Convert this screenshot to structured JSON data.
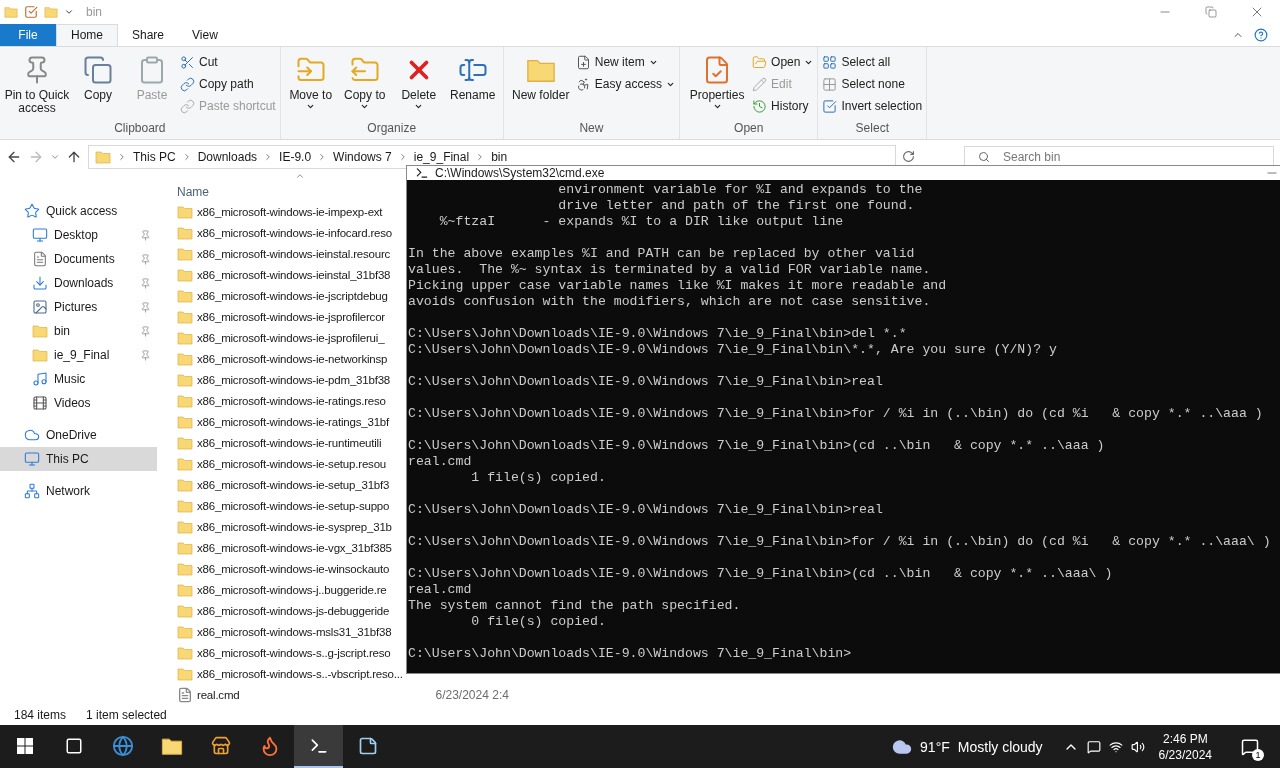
{
  "explorer": {
    "title": "bin",
    "tabs": [
      {
        "label": "File",
        "kind": "file",
        "selected": false
      },
      {
        "label": "Home",
        "kind": "tab",
        "selected": true
      },
      {
        "label": "Share",
        "kind": "tab",
        "selected": false
      },
      {
        "label": "View",
        "kind": "tab",
        "selected": false
      }
    ],
    "ribbon": [
      {
        "label": "Clipboard",
        "large": [
          {
            "label": "Pin to Quick access",
            "kind": "pin",
            "disabled": false,
            "menu": false
          },
          {
            "label": "Copy",
            "kind": "copy",
            "disabled": false,
            "menu": false
          },
          {
            "label": "Paste",
            "kind": "paste",
            "disabled": true,
            "menu": false
          }
        ],
        "small": [
          {
            "label": "Cut",
            "kind": "cut",
            "disabled": false,
            "menu": false
          },
          {
            "label": "Copy path",
            "kind": "path",
            "disabled": false,
            "menu": false
          },
          {
            "label": "Paste shortcut",
            "kind": "shortcut",
            "disabled": true,
            "menu": false
          }
        ]
      },
      {
        "label": "Organize",
        "large": [
          {
            "label": "Move to",
            "kind": "move",
            "disabled": false,
            "menu": true
          },
          {
            "label": "Copy to",
            "kind": "copyto",
            "disabled": false,
            "menu": true
          },
          {
            "label": "Delete",
            "kind": "delete",
            "disabled": false,
            "menu": true
          },
          {
            "label": "Rename",
            "kind": "rename",
            "disabled": false,
            "menu": false
          }
        ]
      },
      {
        "label": "New",
        "large": [
          {
            "label": "New folder",
            "kind": "newfolder",
            "disabled": false,
            "menu": false
          }
        ],
        "small": [
          {
            "label": "New item",
            "kind": "newitem",
            "disabled": false,
            "menu": true
          },
          {
            "label": "Easy access",
            "kind": "easy",
            "disabled": false,
            "menu": true
          }
        ]
      },
      {
        "label": "Open",
        "large": [
          {
            "label": "Properties",
            "kind": "properties",
            "disabled": false,
            "menu": true
          }
        ],
        "small": [
          {
            "label": "Open",
            "kind": "open",
            "disabled": false,
            "menu": true
          },
          {
            "label": "Edit",
            "kind": "edit",
            "disabled": true,
            "menu": false
          },
          {
            "label": "History",
            "kind": "history",
            "disabled": false,
            "menu": false
          }
        ]
      },
      {
        "label": "Select",
        "small": [
          {
            "label": "Select all",
            "kind": "selall",
            "disabled": false,
            "menu": false
          },
          {
            "label": "Select none",
            "kind": "selnone",
            "disabled": false,
            "menu": false
          },
          {
            "label": "Invert selection",
            "kind": "invert",
            "disabled": false,
            "menu": false
          }
        ]
      }
    ],
    "breadcrumbs": [
      "This PC",
      "Downloads",
      "IE-9.0",
      "Windows 7",
      "ie_9_Final",
      "bin"
    ],
    "search": {
      "placeholder": "Search bin"
    },
    "nav": [
      {
        "label": "Quick access",
        "kind": "star",
        "selected": false,
        "children": [
          {
            "label": "Desktop",
            "kind": "desktop",
            "pinned": true,
            "selected": false
          },
          {
            "label": "Documents",
            "kind": "documents",
            "pinned": true,
            "selected": false
          },
          {
            "label": "Downloads",
            "kind": "downloads",
            "pinned": true,
            "selected": false
          },
          {
            "label": "Pictures",
            "kind": "pictures",
            "pinned": true,
            "selected": false
          },
          {
            "label": "bin",
            "kind": "folder",
            "pinned": true,
            "selected": false
          },
          {
            "label": "ie_9_Final",
            "kind": "folder",
            "pinned": true,
            "selected": false
          },
          {
            "label": "Music",
            "kind": "music",
            "pinned": false,
            "selected": false
          },
          {
            "label": "Videos",
            "kind": "videos",
            "pinned": false,
            "selected": false
          }
        ]
      },
      {
        "label": "OneDrive",
        "kind": "cloud",
        "selected": false
      },
      {
        "label": "This PC",
        "kind": "pc",
        "selected": true
      },
      {
        "label": "Network",
        "kind": "network",
        "selected": false
      }
    ],
    "columns": [
      "Name"
    ],
    "files": [
      {
        "name": "x86_microsoft-windows-ie-impexp-ext",
        "kind": "folder"
      },
      {
        "name": "x86_microsoft-windows-ie-infocard.reso",
        "kind": "folder"
      },
      {
        "name": "x86_microsoft-windows-ieinstal.resourc",
        "kind": "folder"
      },
      {
        "name": "x86_microsoft-windows-ieinstal_31bf38",
        "kind": "folder"
      },
      {
        "name": "x86_microsoft-windows-ie-jscriptdebug",
        "kind": "folder"
      },
      {
        "name": "x86_microsoft-windows-ie-jsprofilercor",
        "kind": "folder"
      },
      {
        "name": "x86_microsoft-windows-ie-jsprofilerui_",
        "kind": "folder"
      },
      {
        "name": "x86_microsoft-windows-ie-networkinsp",
        "kind": "folder"
      },
      {
        "name": "x86_microsoft-windows-ie-pdm_31bf38",
        "kind": "folder"
      },
      {
        "name": "x86_microsoft-windows-ie-ratings.reso",
        "kind": "folder"
      },
      {
        "name": "x86_microsoft-windows-ie-ratings_31bf",
        "kind": "folder"
      },
      {
        "name": "x86_microsoft-windows-ie-runtimeutili",
        "kind": "folder"
      },
      {
        "name": "x86_microsoft-windows-ie-setup.resou",
        "kind": "folder"
      },
      {
        "name": "x86_microsoft-windows-ie-setup_31bf3",
        "kind": "folder"
      },
      {
        "name": "x86_microsoft-windows-ie-setup-suppo",
        "kind": "folder"
      },
      {
        "name": "x86_microsoft-windows-ie-sysprep_31b",
        "kind": "folder"
      },
      {
        "name": "x86_microsoft-windows-ie-vgx_31bf385",
        "kind": "folder"
      },
      {
        "name": "x86_microsoft-windows-ie-winsockauto",
        "kind": "folder"
      },
      {
        "name": "x86_microsoft-windows-j..buggeride.re",
        "kind": "folder"
      },
      {
        "name": "x86_microsoft-windows-js-debuggeride",
        "kind": "folder"
      },
      {
        "name": "x86_microsoft-windows-msls31_31bf38",
        "kind": "folder"
      },
      {
        "name": "x86_microsoft-windows-s..g-jscript.reso",
        "kind": "folder"
      },
      {
        "name": "x86_microsoft-windows-s..-vbscript.reso...",
        "kind": "folder"
      },
      {
        "name": "real.cmd",
        "kind": "file",
        "date": "6/23/2024 2:4"
      }
    ],
    "status": [
      "184 items",
      "1 item selected"
    ]
  },
  "console": {
    "title": "C:\\Windows\\System32\\cmd.exe",
    "blocks": [
      [
        "                   environment variable for %I and expands to the",
        "                   drive letter and path of the first one found.",
        "    %~ftzaI      - expands %I to a DIR like output line"
      ],
      [
        "In the above examples %I and PATH can be replaced by other valid",
        "values.  The %~ syntax is terminated by a valid FOR variable name.",
        "Picking upper case variable names like %I makes it more readable and",
        "avoids confusion with the modifiers, which are not case sensitive."
      ],
      [
        "C:\\Users\\John\\Downloads\\IE-9.0\\Windows 7\\ie_9_Final\\bin>del *.*",
        "C:\\Users\\John\\Downloads\\IE-9.0\\Windows 7\\ie_9_Final\\bin\\*.*, Are you sure (Y/N)? y"
      ],
      [
        "C:\\Users\\John\\Downloads\\IE-9.0\\Windows 7\\ie_9_Final\\bin>real"
      ],
      [
        "C:\\Users\\John\\Downloads\\IE-9.0\\Windows 7\\ie_9_Final\\bin>for / %i in (..\\bin) do (cd %i   & copy *.* ..\\aaa )"
      ],
      [
        "C:\\Users\\John\\Downloads\\IE-9.0\\Windows 7\\ie_9_Final\\bin>(cd ..\\bin   & copy *.* ..\\aaa )",
        "real.cmd",
        "        1 file(s) copied."
      ],
      [
        "C:\\Users\\John\\Downloads\\IE-9.0\\Windows 7\\ie_9_Final\\bin>real"
      ],
      [
        "C:\\Users\\John\\Downloads\\IE-9.0\\Windows 7\\ie_9_Final\\bin>for / %i in (..\\bin) do (cd %i   & copy *.* ..\\aaa\\ )"
      ],
      [
        "C:\\Users\\John\\Downloads\\IE-9.0\\Windows 7\\ie_9_Final\\bin>(cd ..\\bin   & copy *.* ..\\aaa\\ )",
        "real.cmd",
        "The system cannot find the path specified.",
        "        0 file(s) copied."
      ],
      [
        "C:\\Users\\John\\Downloads\\IE-9.0\\Windows 7\\ie_9_Final\\bin>"
      ]
    ]
  },
  "taskbar": {
    "apps": [
      {
        "kind": "taskview",
        "active": false
      },
      {
        "kind": "edge",
        "active": false
      },
      {
        "kind": "explorer",
        "active": false
      },
      {
        "kind": "store",
        "active": false
      },
      {
        "kind": "firefox",
        "active": false
      },
      {
        "kind": "cmd",
        "active": true
      },
      {
        "kind": "notepad",
        "active": false
      }
    ],
    "weather": {
      "temp": "91°F",
      "text": "Mostly cloudy"
    },
    "time": "2:46 PM",
    "date": "6/23/2024",
    "notifications": "1"
  }
}
